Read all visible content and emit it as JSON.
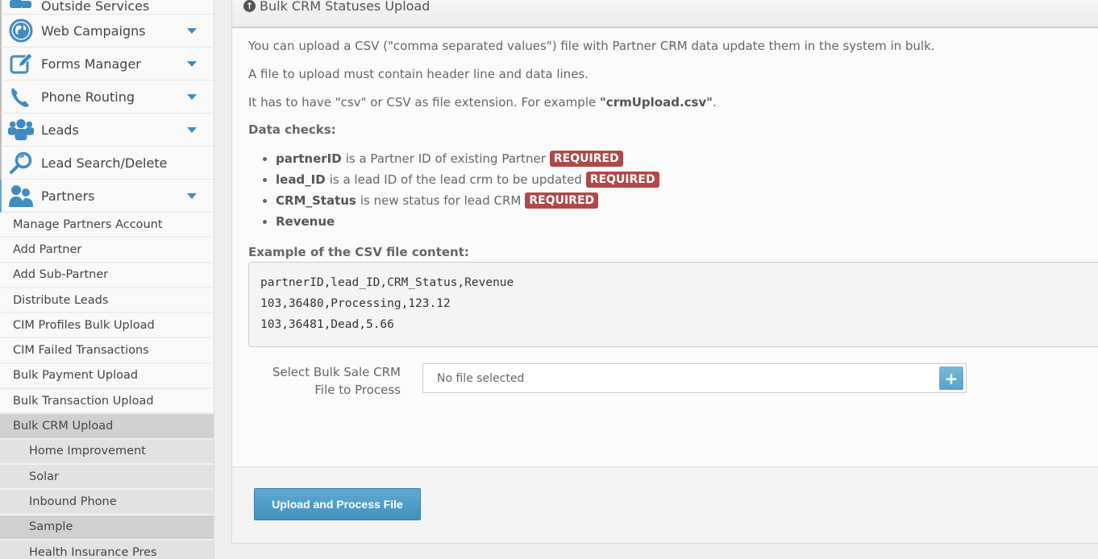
{
  "sidebar": {
    "top_item": {
      "label": "Outside Services",
      "icon": "users-icon"
    },
    "items": [
      {
        "label": "Web Campaigns",
        "icon": "globe-icon",
        "has_caret": true
      },
      {
        "label": "Forms Manager",
        "icon": "edit-icon",
        "has_caret": true
      },
      {
        "label": "Phone Routing",
        "icon": "phone-icon",
        "has_caret": true
      },
      {
        "label": "Leads",
        "icon": "group-icon",
        "has_caret": true
      },
      {
        "label": "Lead Search/Delete",
        "icon": "search-icon",
        "has_caret": false
      },
      {
        "label": "Partners",
        "icon": "partners-icon",
        "has_caret": true
      }
    ],
    "sub_items": [
      {
        "label": "Manage Partners Account"
      },
      {
        "label": "Add Partner"
      },
      {
        "label": "Add Sub-Partner"
      },
      {
        "label": "Distribute Leads"
      },
      {
        "label": "CIM Profiles Bulk Upload"
      },
      {
        "label": "CIM Failed Transactions"
      },
      {
        "label": "Bulk Payment Upload"
      },
      {
        "label": "Bulk Transaction Upload"
      },
      {
        "label": "Bulk CRM Upload",
        "active": true
      }
    ],
    "sub_sub_items": [
      {
        "label": "Home Improvement"
      },
      {
        "label": "Solar"
      },
      {
        "label": "Inbound Phone"
      },
      {
        "label": "Sample",
        "active": true
      },
      {
        "label": "Health Insurance Pres"
      }
    ]
  },
  "panel": {
    "title": "Bulk CRM Statuses Upload",
    "title_icon": "upload-circle-icon",
    "intro": "You can upload a CSV (\"comma separated values\") file with Partner CRM data update them in the system in bulk.",
    "requirement": "A file to upload must contain header line and data lines.",
    "extension_prefix": "It has to have \"csv\" or CSV as file extension. For example ",
    "extension_example": "\"crmUpload.csv\"",
    "extension_suffix": ".",
    "data_checks_label": "Data checks:",
    "checks": [
      {
        "field": "partnerID",
        "desc": "is a Partner ID of existing Partner",
        "badge": "REQUIRED"
      },
      {
        "field": "lead_ID",
        "desc": "is a lead ID of the lead crm to be updated",
        "badge": "REQUIRED"
      },
      {
        "field": "CRM_Status",
        "desc": "is new status for lead CRM",
        "badge": "REQUIRED"
      },
      {
        "field": "Revenue",
        "desc": "",
        "badge": ""
      }
    ],
    "example_label": "Example of the CSV file content:",
    "example_lines": [
      "partnerID,lead_ID,CRM_Status,Revenue",
      "103,36480,Processing,123.12",
      "103,36481,Dead,5.66"
    ],
    "file_label": "Select Bulk Sale CRM File to Process",
    "file_placeholder": "No file selected",
    "file_add_symbol": "+",
    "submit_label": "Upload and Process File"
  },
  "colors": {
    "accent": "#4a9acb",
    "required_badge": "#b0484a",
    "active_menu": "#d0d0d0"
  }
}
